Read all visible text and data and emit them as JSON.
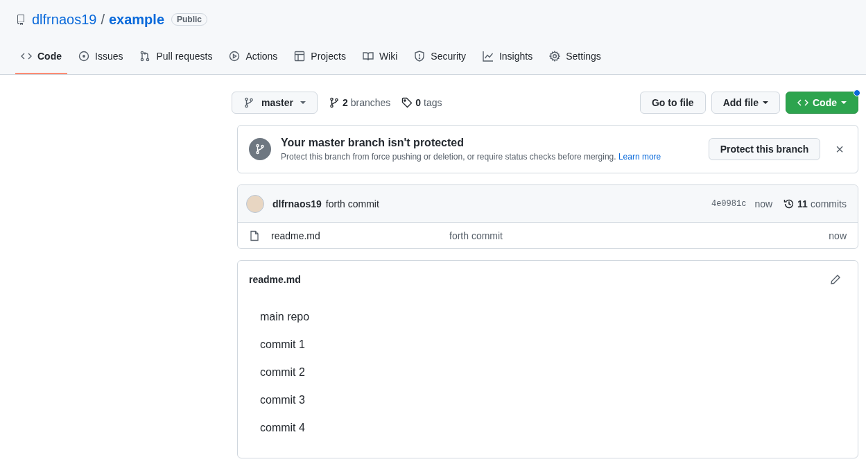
{
  "repo": {
    "owner": "dlfrnaos19",
    "separator": "/",
    "name": "example",
    "visibility": "Public"
  },
  "tabs": [
    {
      "label": "Code",
      "selected": true
    },
    {
      "label": "Issues",
      "selected": false
    },
    {
      "label": "Pull requests",
      "selected": false
    },
    {
      "label": "Actions",
      "selected": false
    },
    {
      "label": "Projects",
      "selected": false
    },
    {
      "label": "Wiki",
      "selected": false
    },
    {
      "label": "Security",
      "selected": false
    },
    {
      "label": "Insights",
      "selected": false
    },
    {
      "label": "Settings",
      "selected": false
    }
  ],
  "toolbar": {
    "branch": "master",
    "branches_count": "2",
    "branches_label": "branches",
    "tags_count": "0",
    "tags_label": "tags",
    "go_to_file": "Go to file",
    "add_file": "Add file",
    "code": "Code"
  },
  "protect_notice": {
    "title": "Your master branch isn't protected",
    "text": "Protect this branch from force pushing or deletion, or require status checks before merging.",
    "link": "Learn more",
    "button": "Protect this branch",
    "close": "×"
  },
  "latest_commit": {
    "author": "dlfrnaos19",
    "message": "forth commit",
    "sha": "4e0981c",
    "time": "now",
    "commits_count": "11",
    "commits_label": "commits"
  },
  "files": [
    {
      "name": "readme.md",
      "message": "forth commit",
      "time": "now"
    }
  ],
  "readme": {
    "title": "readme.md",
    "lines": [
      "main repo",
      "commit 1",
      "commit 2",
      "commit 3",
      "commit 4"
    ]
  }
}
